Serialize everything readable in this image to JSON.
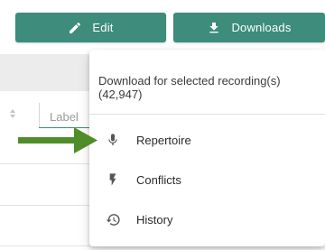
{
  "toolbar": {
    "edit_label": "Edit",
    "edit_icon": "pencil-icon",
    "downloads_label": "Downloads",
    "downloads_icon": "download-icon",
    "accent": "#3d8c7c"
  },
  "table": {
    "label_placeholder": "Label"
  },
  "downloads_menu": {
    "caption_line1": "Download for selected recording(s)",
    "caption_line2": "(42,947)",
    "items": [
      {
        "label": "Repertoire",
        "icon": "microphone-icon"
      },
      {
        "label": "Conflicts",
        "icon": "lightning-icon"
      },
      {
        "label": "History",
        "icon": "history-icon"
      }
    ]
  },
  "annotation": {
    "arrow_color": "#4e8d2a"
  }
}
